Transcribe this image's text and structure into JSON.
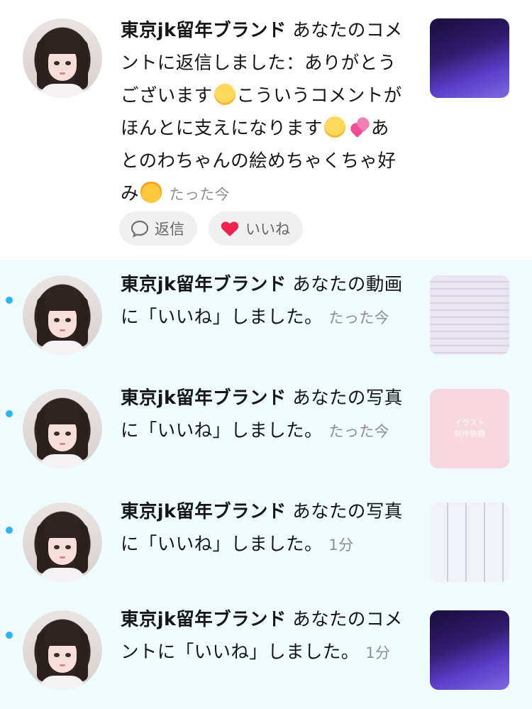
{
  "notifications": [
    {
      "sender": "東京jk留年ブランド",
      "message_before": "あなたのコメントに返信しました：ありがとうございます",
      "message_middle": "こういうコメントがほんとに支えになります",
      "message_after": "あとのわちゃんの絵めちゃくちゃ好み",
      "time": "たった今",
      "unread": false,
      "thumbnail": "purple",
      "actions": {
        "reply_label": "返信",
        "like_label": "いいね"
      }
    },
    {
      "sender": "東京jk留年ブランド",
      "message": "あなたの動画に「いいね」しました。",
      "time": "たった今",
      "unread": true,
      "thumbnail": "paper"
    },
    {
      "sender": "東京jk留年ブランド",
      "message": "あなたの写真に「いいね」しました。",
      "time": "たった今",
      "unread": true,
      "thumbnail": "pink",
      "thumbnail_text": "イラスト\n制作依頼"
    },
    {
      "sender": "東京jk留年ブランド",
      "message": "あなたの写真に「いいね」しました。",
      "time": "1分",
      "unread": true,
      "thumbnail": "manga"
    },
    {
      "sender": "東京jk留年ブランド",
      "message": "あなたのコメントに「いいね」しました。",
      "time": "1分",
      "unread": true,
      "thumbnail": "purple"
    }
  ],
  "colors": {
    "unread_dot": "#2bb5f2",
    "unread_bg": "#f0fbfe",
    "like_heart": "#f0234e"
  },
  "icons": {
    "reply": "speech-bubble-icon",
    "like": "heart-icon"
  }
}
